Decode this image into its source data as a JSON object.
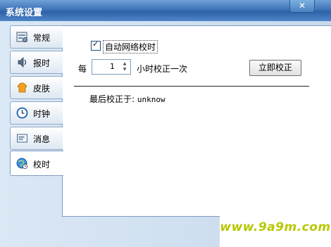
{
  "window": {
    "title": "系统设置",
    "close_label": "✕"
  },
  "tabs": [
    {
      "label": "常规",
      "icon": "general-settings-icon"
    },
    {
      "label": "报时",
      "icon": "speaker-icon"
    },
    {
      "label": "皮肤",
      "icon": "skin-icon"
    },
    {
      "label": "时钟",
      "icon": "clock-icon"
    },
    {
      "label": "消息",
      "icon": "message-icon"
    },
    {
      "label": "校时",
      "icon": "time-sync-icon"
    }
  ],
  "active_tab": "校时",
  "sync": {
    "auto_label": "自动网络校时",
    "auto_checked": true,
    "every_label": "每",
    "hours_value": "1",
    "hours_label": "小时校正一次",
    "calibrate_button": "立即校正",
    "last_label": "最后校正于:",
    "last_value": "unknow"
  },
  "watermark": {
    "text": "www.9a9m.com"
  },
  "colors": {
    "title_bar": "#3e74b8",
    "panel": "#c7d9ec",
    "watermark": "#b8c800"
  }
}
